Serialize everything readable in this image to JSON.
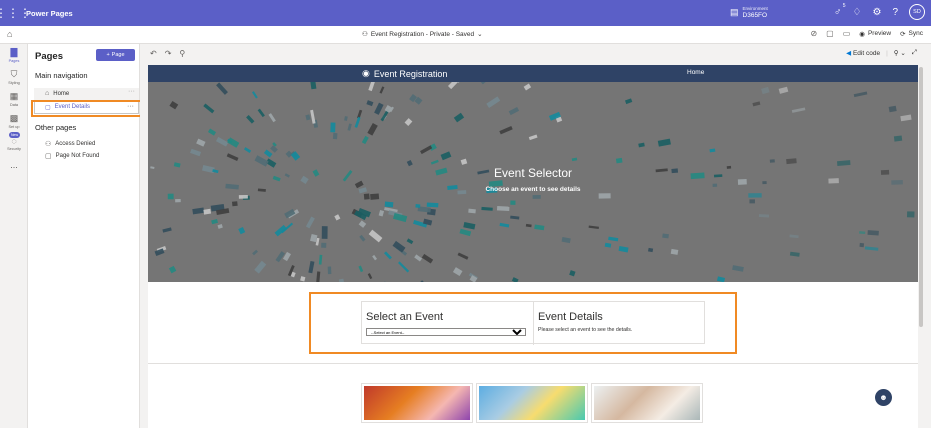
{
  "topbar": {
    "app_title": "Power Pages",
    "environment_label": "Environment",
    "environment_name": "D365FO",
    "avatar_initials": "SD",
    "notification_count": "5"
  },
  "subbar": {
    "site_status": "Event Registration - Private - Saved",
    "preview": "Preview",
    "sync": "Sync"
  },
  "rail": {
    "items": [
      "Pages",
      "Styling",
      "Data",
      "Set up",
      "Security"
    ],
    "new_badge": "New",
    "more": "..."
  },
  "panel": {
    "title": "Pages",
    "add_button": "Page",
    "main_nav_heading": "Main navigation",
    "home": "Home",
    "event_details": "Event Details",
    "other_pages_heading": "Other pages",
    "access_denied": "Access Denied",
    "page_not_found": "Page Not Found",
    "more": "..."
  },
  "toolbar": {
    "edit_code": "Edit code"
  },
  "site": {
    "brand": "Event Registration",
    "nav_home": "Home",
    "hero_title": "Event Selector",
    "hero_subtitle": "Choose an event to see details",
    "select_heading": "Select an Event",
    "select_value": "--Select an Event--",
    "details_heading": "Event Details",
    "details_text": "Please select an event to see the details."
  },
  "colors": {
    "brand_purple": "#5b5fc7",
    "site_nav": "#2f4366",
    "highlight_orange": "#f08a24"
  }
}
